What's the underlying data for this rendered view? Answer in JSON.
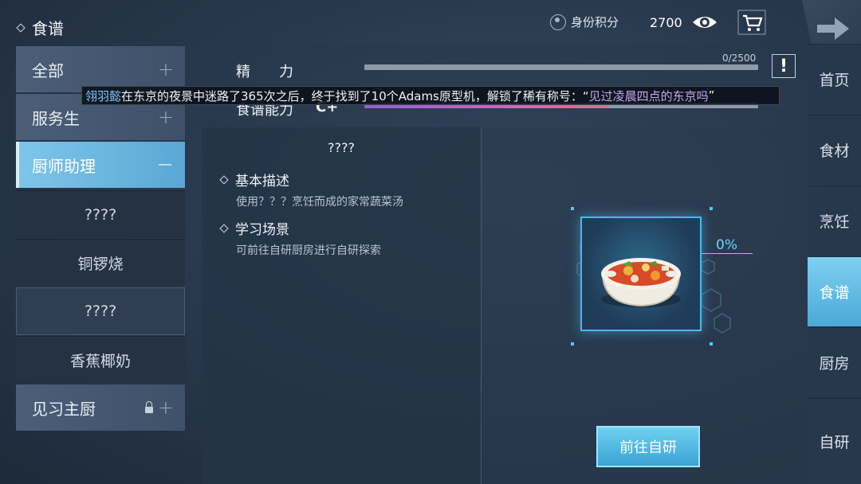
{
  "header": {
    "title": "食谱",
    "score_label": "身份积分",
    "score_value": "2700"
  },
  "categories": [
    {
      "label": "全部",
      "state": "collapsed"
    },
    {
      "label": "服务生",
      "state": "collapsed"
    },
    {
      "label": "厨师助理",
      "state": "expanded",
      "items": [
        "????",
        "铜锣烧",
        "????",
        "香蕉椰奶"
      ]
    },
    {
      "label": "见习主厨",
      "state": "locked"
    }
  ],
  "stats": {
    "energy": {
      "label": "精　　力",
      "value": "0/2500",
      "fraction": 0.0
    },
    "ability": {
      "label": "食谱能力",
      "grade": "C+",
      "fraction": 0.62
    }
  },
  "detail": {
    "dish_name": "????",
    "desc_heading": "基本描述",
    "desc_text": "使用？？？烹饪而成的家常蔬菜汤",
    "scene_heading": "学习场景",
    "scene_text": "可前往自研厨房进行自研探索",
    "progress": "0%",
    "research_button": "前往自研"
  },
  "nav": [
    "首页",
    "食材",
    "烹饪",
    "食谱",
    "厨房",
    "自研"
  ],
  "nav_active": "食谱",
  "banner": {
    "player": "翎羽懿",
    "message": "在东京的夜景中迷路了365次之后，终于找到了10个Adams原型机，解锁了稀有称号：“",
    "title": "见过凌晨四点的东京吗",
    "suffix": "”"
  },
  "colors": {
    "accent": "#4bb8ea",
    "active_tab": "#5aa7d4",
    "bar_fill": "#c067c6"
  }
}
